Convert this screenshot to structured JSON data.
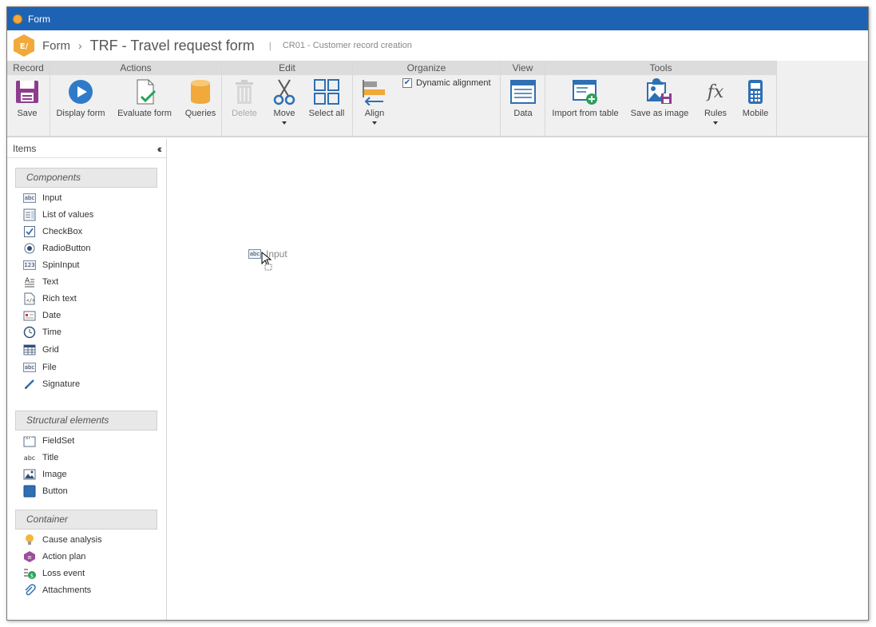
{
  "window": {
    "title": "Form"
  },
  "breadcrumb": {
    "root": "Form",
    "separator": "›",
    "title": "TRF - Travel request form",
    "pipe": "|",
    "subtitle": "CR01 - Customer record creation"
  },
  "ribbon": {
    "groups": {
      "record": "Record",
      "actions": "Actions",
      "edit": "Edit",
      "organize": "Organize",
      "view": "View",
      "tools": "Tools"
    },
    "buttons": {
      "save": "Save",
      "display_form": "Display form",
      "evaluate_form": "Evaluate form",
      "queries": "Queries",
      "delete": "Delete",
      "move": "Move",
      "select_all": "Select all",
      "align": "Align",
      "dynamic_alignment": "Dynamic alignment",
      "data": "Data",
      "import_from_table": "Import from table",
      "save_as_image": "Save as image",
      "rules": "Rules",
      "mobile": "Mobile"
    },
    "dynamic_alignment_checked": true
  },
  "sidebar": {
    "title": "Items",
    "sections": {
      "components": "Components",
      "structural": "Structural elements",
      "container": "Container"
    },
    "components": [
      "Input",
      "List of values",
      "CheckBox",
      "RadioButton",
      "SpinInput",
      "Text",
      "Rich text",
      "Date",
      "Time",
      "Grid",
      "File",
      "Signature"
    ],
    "structural": [
      "FieldSet",
      "Title",
      "Image",
      "Button"
    ],
    "container": [
      "Cause analysis",
      "Action plan",
      "Loss event",
      "Attachments"
    ]
  },
  "canvas": {
    "dragging_item_label": "Input",
    "drag_icon_text": "abc"
  },
  "icons": {
    "input_icon_text": "abc",
    "spin_icon_text": "123",
    "title_icon_text": "abc",
    "file_icon_text": "abc"
  }
}
